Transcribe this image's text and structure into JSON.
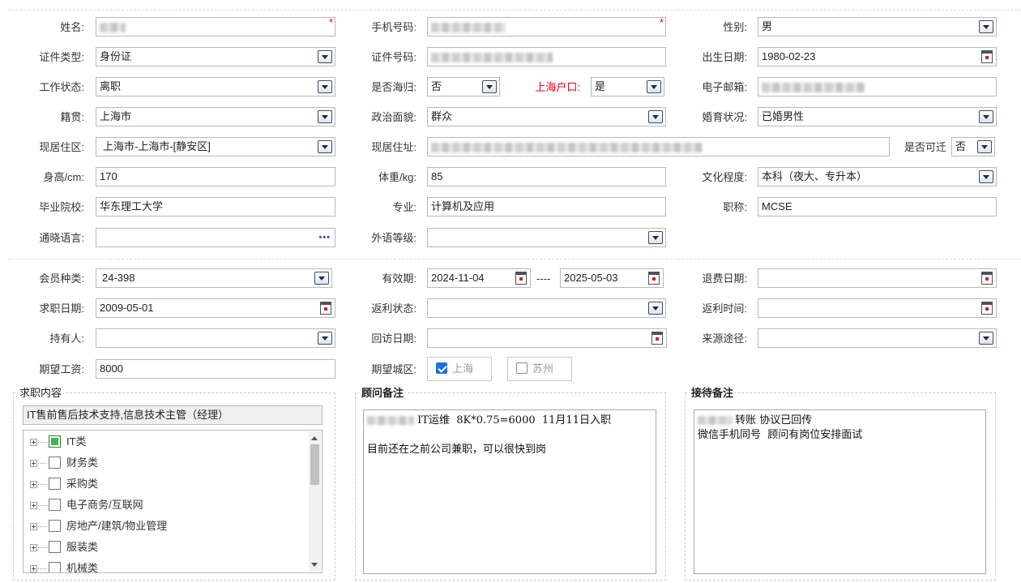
{
  "basic": {
    "name": {
      "label": "姓名:",
      "value": ""
    },
    "phone": {
      "label": "手机号码:",
      "value": ""
    },
    "gender": {
      "label": "性别:",
      "value": "男"
    },
    "id_type": {
      "label": "证件类型:",
      "value": "身份证"
    },
    "id_number": {
      "label": "证件号码:",
      "value": ""
    },
    "birth_date": {
      "label": "出生日期:",
      "value": "1980-02-23"
    },
    "work_status": {
      "label": "工作状态:",
      "value": "离职"
    },
    "returnee": {
      "label": "是否海归:",
      "value": "否"
    },
    "sh_hukou": {
      "label": "上海户口:",
      "value": "是"
    },
    "email": {
      "label": "电子邮箱:",
      "value": ""
    },
    "native_place": {
      "label": "籍贯:",
      "value": "上海市"
    },
    "political": {
      "label": "政治面貌:",
      "value": "群众"
    },
    "marital": {
      "label": "婚育状况:",
      "value": "已婚男性"
    },
    "residence_area": {
      "label": "现居住区:",
      "value": "上海市-上海市-[静安区]"
    },
    "residence_addr": {
      "label": "现居住址:",
      "value": ""
    },
    "relocatable": {
      "label": "是否可迁",
      "value": "否"
    },
    "height": {
      "label": "身高/cm:",
      "value": "170"
    },
    "weight": {
      "label": "体重/kg:",
      "value": "85"
    },
    "education": {
      "label": "文化程度:",
      "value": "本科（夜大、专升本）"
    },
    "school": {
      "label": "毕业院校:",
      "value": "华东理工大学"
    },
    "major": {
      "label": "专业:",
      "value": "计算机及应用"
    },
    "title": {
      "label": "职称:",
      "value": "MCSE"
    },
    "languages": {
      "label": "通晓语言:",
      "value": ""
    },
    "lang_level": {
      "label": "外语等级:",
      "value": ""
    }
  },
  "membership": {
    "member_type": {
      "label": "会员种类:",
      "value": "24-398"
    },
    "valid_period": {
      "label": "有效期:",
      "from": "2024-11-04",
      "separator": "----",
      "to": "2025-05-03"
    },
    "refund_date": {
      "label": "退费日期:",
      "value": ""
    },
    "job_seek_date": {
      "label": "求职日期:",
      "value": "2009-05-01"
    },
    "rebate_status": {
      "label": "返利状态:",
      "value": ""
    },
    "rebate_time": {
      "label": "返利时间:",
      "value": ""
    },
    "holder": {
      "label": "持有人:",
      "value": ""
    },
    "revisit_date": {
      "label": "回访日期:",
      "value": ""
    },
    "source": {
      "label": "来源途径:",
      "value": ""
    },
    "expected_salary": {
      "label": "期望工资:",
      "value": "8000"
    },
    "expected_city": {
      "label": "期望城区:",
      "options": [
        {
          "label": "上海",
          "checked": true
        },
        {
          "label": "苏州",
          "checked": false
        }
      ]
    }
  },
  "job_content": {
    "legend": "求职内容",
    "summary": "IT售前售后技术支持,信息技术主管（经理）",
    "tree": [
      {
        "label": "IT类",
        "checked": true
      },
      {
        "label": "财务类",
        "checked": false
      },
      {
        "label": "采购类",
        "checked": false
      },
      {
        "label": "电子商务/互联网",
        "checked": false
      },
      {
        "label": "房地产/建筑/物业管理",
        "checked": false
      },
      {
        "label": "服装类",
        "checked": false
      },
      {
        "label": "机械类",
        "checked": false
      }
    ]
  },
  "consultant_note": {
    "legend": "顾问备注",
    "line1": "IT运维  8K*0.75=6000  11月11日入职",
    "line2": "目前还在之前公司兼职，可以很快到岗"
  },
  "reception_note": {
    "legend": "接待备注",
    "line1": "转账 协议已回传",
    "line2": "微信手机同号  顾问有岗位安排面试"
  },
  "icons": {
    "dropdown": "chevron-down-icon",
    "calendar": "calendar-icon",
    "more": "ellipsis-icon",
    "required": "asterisk"
  },
  "colors": {
    "required": "#e60012",
    "checkbox_on": "#1f6fdd",
    "tree_checked": "#3fb54a"
  }
}
